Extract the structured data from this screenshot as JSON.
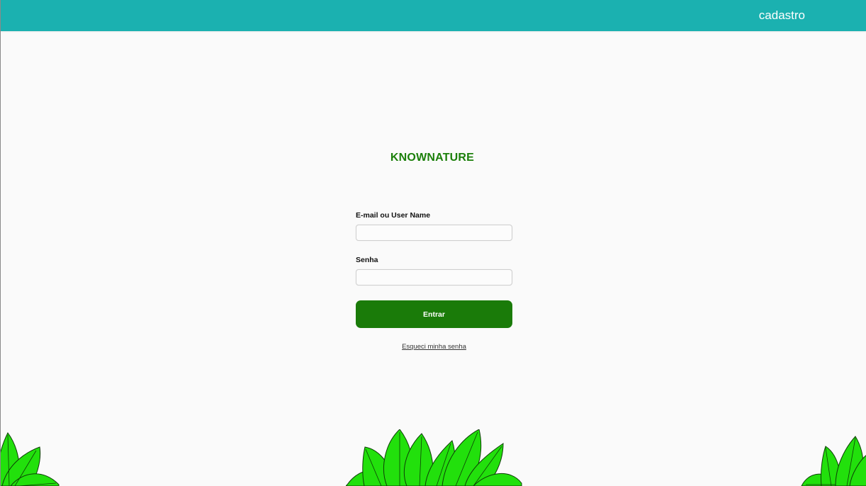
{
  "header": {
    "cadastro_label": "cadastro"
  },
  "brand": {
    "title": "KNOWNATURE"
  },
  "login_form": {
    "email_label": "E-mail ou User Name",
    "email_value": "",
    "password_label": "Senha",
    "password_value": "",
    "submit_label": "Entrar",
    "forgot_label": "Esqueci minha senha"
  },
  "colors": {
    "topbar": "#1bb1b0",
    "brand_green": "#1b7f0a",
    "button_green": "#1a7b09",
    "leaf_green": "#22e00c",
    "page_background": "#fafafa"
  },
  "decorations": {
    "leaf_icon": "leaf-cluster-icon"
  }
}
